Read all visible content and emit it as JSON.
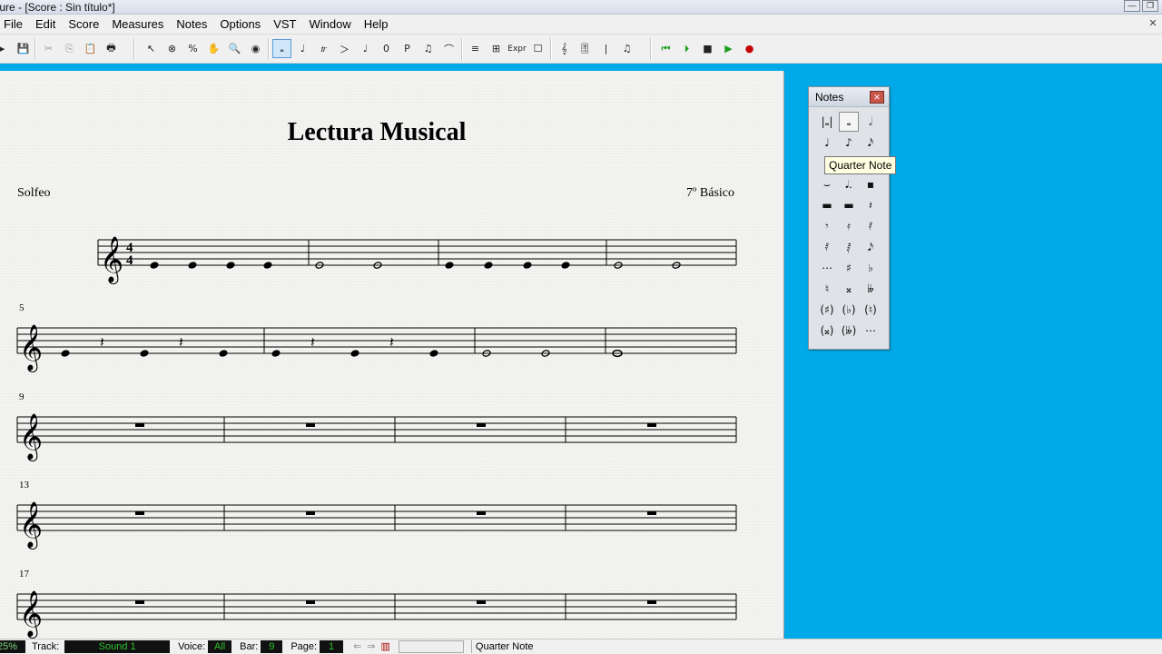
{
  "window": {
    "title": "rture - [Score : Sin título*]"
  },
  "menu": [
    "File",
    "Edit",
    "Score",
    "Measures",
    "Notes",
    "Options",
    "VST",
    "Window",
    "Help"
  ],
  "toolbar": {
    "file_tools": [
      "💾",
      "✂",
      "⎘",
      "📋",
      "🖶"
    ],
    "edit_tools": [
      "↖",
      "⊗",
      "%",
      "✋",
      "🔍",
      "◉"
    ],
    "note_tools": [
      "𝅝",
      "♩",
      "𝆖",
      "＞",
      "♩",
      "0",
      "P",
      "♫",
      "⌒"
    ],
    "misc_tools": [
      "≡",
      "⊞",
      "Expr",
      "☐",
      "𝄞",
      "🎚",
      "|",
      "♫"
    ],
    "transport": [
      "⏮",
      "⏵",
      "■",
      "▶",
      "●"
    ],
    "colors": {
      "play": "#1e9e1e",
      "record": "#c40000",
      "active": "#cfe6fb"
    }
  },
  "score": {
    "title": "Lectura Musical",
    "subtitle_left": "Solfeo",
    "subtitle_right": "7º Básico",
    "time_signature": "4/4",
    "bar_numbers": [
      "5",
      "9",
      "13",
      "17"
    ]
  },
  "palette": {
    "title": "Notes",
    "tooltip": "Quarter Note",
    "rows": [
      [
        "|𝅝|",
        "𝅝",
        "𝅗𝅥"
      ],
      [
        "♩",
        "♪",
        "𝅘𝅥𝅯"
      ],
      [
        "",
        "",
        ""
      ],
      [
        "⌣",
        "𝅘𝅥.",
        "▪"
      ],
      [
        "▬",
        "▬",
        "𝄽"
      ],
      [
        "𝄾",
        "𝄿",
        "𝅀"
      ],
      [
        "𝅀",
        "𝅁",
        "𝅘𝅥𝅯"
      ],
      [
        "⋯",
        "♯",
        "♭"
      ],
      [
        "♮",
        "𝄪",
        "𝄫"
      ],
      [
        "(♯)",
        "(♭)",
        "(♮)"
      ],
      [
        "(𝄪)",
        "(𝄫)",
        "⋯"
      ]
    ]
  },
  "status": {
    "zoom": "25%",
    "track_label": "Track:",
    "track_value": "Sound 1",
    "voice_label": "Voice:",
    "voice_value": "All",
    "bar_label": "Bar:",
    "bar_value": "9",
    "page_label": "Page:",
    "page_value": "1",
    "message": "Quarter Note"
  }
}
